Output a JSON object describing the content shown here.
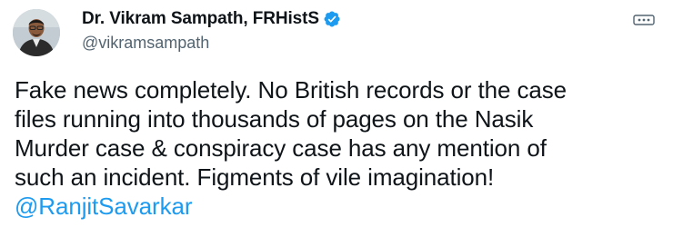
{
  "author": {
    "display_name": "Dr. Vikram Sampath, FRHistS",
    "handle": "@vikramsampath",
    "verified": true,
    "avatar_icon": "profile-photo"
  },
  "tweet": {
    "lines": [
      "Fake news completely. No British records or the case",
      "files running into thousands of pages on the Nasik",
      "Murder case & conspiracy case has any mention of",
      "such an incident. Figments of vile imagination!"
    ],
    "mention": "@RanjitSavarkar"
  },
  "colors": {
    "verified_badge": "#1d9bf0",
    "mention": "#1d9bf0",
    "handle": "#536471",
    "text": "#0f1419"
  },
  "icons": {
    "more": "more-options-icon",
    "verified": "verified-badge-icon"
  }
}
